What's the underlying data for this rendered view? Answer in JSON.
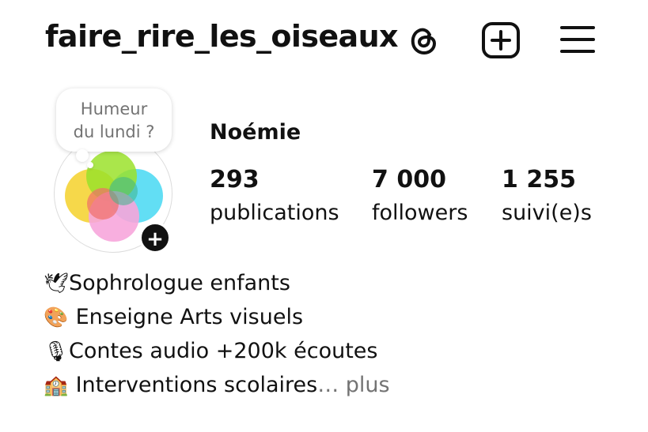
{
  "header": {
    "username": "faire_rire_les_oiseaux",
    "icons": [
      "threads-icon",
      "new-post-icon",
      "menu-icon"
    ]
  },
  "note": {
    "line1": "Humeur",
    "line2": "du lundi ?"
  },
  "profile": {
    "display_name": "Noémie",
    "add_story_symbol": "+"
  },
  "stats": {
    "posts": {
      "value": "293",
      "label": "publications"
    },
    "followers": {
      "value": "7 000",
      "label": "followers"
    },
    "following": {
      "value": "1 255",
      "label": "suivi(e)s"
    }
  },
  "bio": {
    "lines": [
      {
        "emoji": "🕊",
        "text": "Sophrologue enfants"
      },
      {
        "emoji": "🎨",
        "text": " Enseigne Arts visuels"
      },
      {
        "emoji": "🎙",
        "text": "Contes audio +200k écoutes"
      },
      {
        "emoji": "🏫",
        "text": " Interventions scolaires"
      }
    ],
    "more_label": "… plus"
  },
  "colors": {
    "text": "#111111",
    "muted": "#737373",
    "avatar_yellow": "#f5d12a",
    "avatar_green": "#9be22b",
    "avatar_cyan": "#47d8f2",
    "avatar_pink": "#f7a6dc",
    "avatar_red": "#ef6f6a"
  }
}
